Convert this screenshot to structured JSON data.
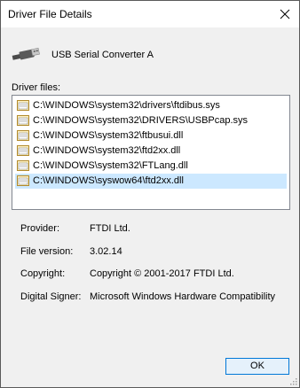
{
  "window": {
    "title": "Driver File Details"
  },
  "device": {
    "name": "USB Serial Converter A",
    "icon": "usb-plug-icon"
  },
  "files": {
    "label": "Driver files:",
    "items": [
      {
        "path": "C:\\WINDOWS\\system32\\drivers\\ftdibus.sys",
        "selected": false
      },
      {
        "path": "C:\\WINDOWS\\system32\\DRIVERS\\USBPcap.sys",
        "selected": false
      },
      {
        "path": "C:\\WINDOWS\\system32\\ftbusui.dll",
        "selected": false
      },
      {
        "path": "C:\\WINDOWS\\system32\\ftd2xx.dll",
        "selected": false
      },
      {
        "path": "C:\\WINDOWS\\system32\\FTLang.dll",
        "selected": false
      },
      {
        "path": "C:\\WINDOWS\\syswow64\\ftd2xx.dll",
        "selected": true
      }
    ]
  },
  "details": {
    "provider_label": "Provider:",
    "provider_value": "FTDI Ltd.",
    "version_label": "File version:",
    "version_value": "3.02.14",
    "copyright_label": "Copyright:",
    "copyright_value": "Copyright © 2001-2017 FTDI Ltd.",
    "signer_label": "Digital Signer:",
    "signer_value": "Microsoft Windows Hardware Compatibility"
  },
  "buttons": {
    "ok_label": "OK"
  },
  "colors": {
    "selection": "#cce8ff",
    "accent": "#0078d7",
    "button_bg": "#e5f1fb"
  }
}
